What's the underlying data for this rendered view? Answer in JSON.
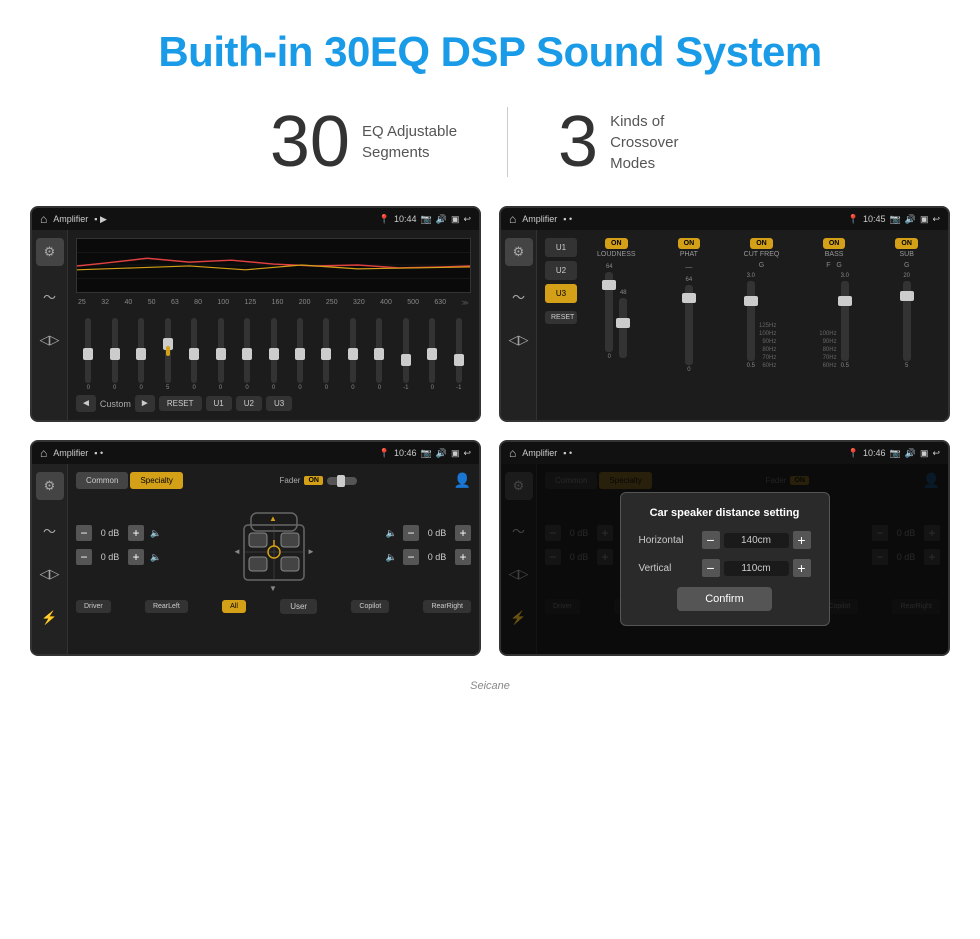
{
  "page": {
    "title": "Buith-in 30EQ DSP Sound System",
    "stat1_number": "30",
    "stat1_desc": "EQ Adjustable\nSegments",
    "stat2_number": "3",
    "stat2_desc": "Kinds of\nCrossover Modes"
  },
  "screens": {
    "top_left": {
      "title": "Amplifier",
      "time": "10:44",
      "eq_freqs": [
        "25",
        "32",
        "40",
        "50",
        "63",
        "80",
        "100",
        "125",
        "160",
        "200",
        "250",
        "320",
        "400",
        "500",
        "630"
      ],
      "eq_vals": [
        "0",
        "0",
        "0",
        "5",
        "0",
        "0",
        "0",
        "0",
        "0",
        "0",
        "0",
        "0",
        "-1",
        "0",
        "-1"
      ],
      "controls": {
        "play_label": "Custom",
        "reset": "RESET",
        "u1": "U1",
        "u2": "U2",
        "u3": "U3"
      }
    },
    "top_right": {
      "title": "Amplifier",
      "time": "10:45",
      "channels": [
        "LOUDNESS",
        "PHAT",
        "CUT FREQ",
        "BASS",
        "SUB"
      ],
      "presets": [
        "U1",
        "U2",
        "U3"
      ],
      "active_preset": "U3",
      "reset": "RESET"
    },
    "bottom_left": {
      "title": "Amplifier",
      "time": "10:46",
      "tabs": [
        "Common",
        "Specialty"
      ],
      "active_tab": "Specialty",
      "fader_label": "Fader",
      "fader_on": "ON",
      "db_values": [
        "0 dB",
        "0 dB",
        "0 dB",
        "0 dB"
      ],
      "positions": [
        "Driver",
        "RearLeft",
        "All",
        "User",
        "Copilot",
        "RearRight"
      ]
    },
    "bottom_right": {
      "title": "Amplifier",
      "time": "10:46",
      "tabs": [
        "Common",
        "Specialty"
      ],
      "dialog": {
        "title": "Car speaker distance setting",
        "horizontal_label": "Horizontal",
        "horizontal_value": "140cm",
        "vertical_label": "Vertical",
        "vertical_value": "110cm",
        "confirm_label": "Confirm"
      }
    }
  },
  "watermark": "Seicane"
}
